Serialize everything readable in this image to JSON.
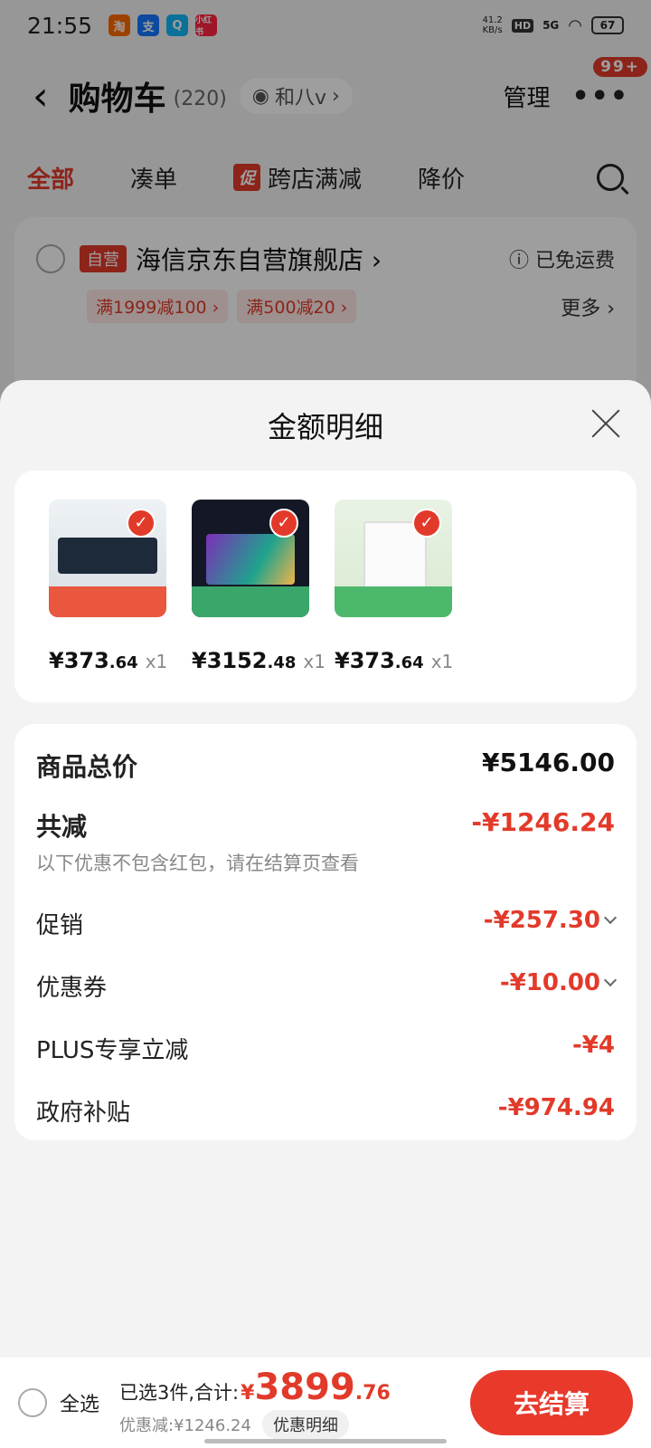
{
  "status": {
    "time": "21:55",
    "apps": [
      {
        "text": "淘",
        "color": "#ff6a00"
      },
      {
        "text": "支",
        "color": "#1677ff"
      },
      {
        "text": "Q",
        "color": "#12b7f5"
      },
      {
        "text": "小红书",
        "color": "#ff2442"
      }
    ],
    "speed": "41.2",
    "speed_unit": "KB/s",
    "hd": "HD",
    "network": "5G",
    "battery": "67"
  },
  "header": {
    "back_icon": "‹",
    "title": "购物车",
    "count": "(220)",
    "address": "和八v",
    "manage": "管理",
    "more_dots": "•••",
    "more_badge": "99+"
  },
  "tabs": [
    {
      "label": "全部",
      "active": true
    },
    {
      "label": "凑单"
    },
    {
      "label": "跨店满减",
      "tag": "促"
    },
    {
      "label": "降价"
    }
  ],
  "store": {
    "self_tag": "自营",
    "name": "海信京东自营旗舰店 ›",
    "free_shipping": "ⓘ 已免运费",
    "coupons": [
      "满1999减100 ›",
      "满500减20 ›"
    ],
    "more": "更多 ›"
  },
  "sheet": {
    "title": "金额明细",
    "goods": [
      {
        "price_int": "¥373",
        "price_dec": ".64",
        "qty": "x1",
        "thumb": "hob"
      },
      {
        "price_int": "¥3152",
        "price_dec": ".48",
        "qty": "x1",
        "thumb": "tv"
      },
      {
        "price_int": "¥373",
        "price_dec": ".64",
        "qty": "x1",
        "thumb": "fridge"
      }
    ],
    "details": {
      "total_label": "商品总价",
      "total_value": "¥5146.00",
      "reduce_label": "共减",
      "reduce_value": "-¥1246.24",
      "reduce_note": "以下优惠不包含红包，请在结算页查看",
      "rows": [
        {
          "label": "促销",
          "value": "-¥257.30",
          "expand": true
        },
        {
          "label": "优惠券",
          "value": "-¥10.00",
          "expand": true
        },
        {
          "label": "PLUS专享立减",
          "value": "-¥4",
          "expand": false
        },
        {
          "label": "政府补贴",
          "value": "-¥974.94",
          "expand": false
        }
      ]
    }
  },
  "bottom": {
    "select_all": "全选",
    "selected_text": "已选3件,合计:",
    "total_currency": "¥",
    "total_int": "3899",
    "total_dec": ".76",
    "discount_text": "优惠减:¥1246.24",
    "detail_button": "优惠明细",
    "checkout": "去结算"
  }
}
